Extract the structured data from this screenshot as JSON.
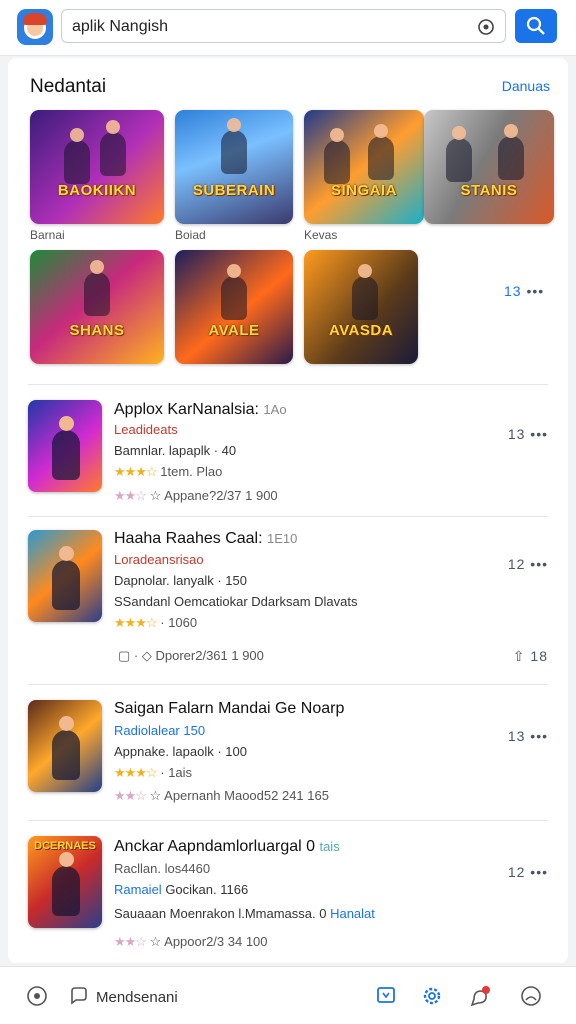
{
  "search": {
    "query": "aplik Nangish"
  },
  "section": {
    "title": "Nedantai",
    "link": "Danuas",
    "captions": [
      "Barnai",
      "Boiad",
      "Kevas"
    ],
    "more_count": "13",
    "tiles": [
      {
        "label": "BAOKIIKN",
        "bg": "linear-gradient(135deg,#3a1d7a,#b02fb8 55%,#ff7a2a)"
      },
      {
        "label": "SUBERAIN",
        "bg": "linear-gradient(160deg,#2e7fd9,#7ac0ff 40%,#3b3a6e)"
      },
      {
        "label": "SINGAIA",
        "bg": "linear-gradient(140deg,#1f3a8a,#ff9d2e 50%,#19b0c9)"
      },
      {
        "label": "STANIS",
        "bg": "linear-gradient(120deg,#c7c7c7,#7b7b7b 45%,#d9592a)"
      },
      {
        "label": "SHANS",
        "bg": "linear-gradient(140deg,#1e8a3a,#c72a7c 45%,#ffb21e)"
      },
      {
        "label": "AVALE",
        "bg": "linear-gradient(140deg,#1b1f5c,#ff6a1a 55%,#2a1b4a)"
      },
      {
        "label": "AVASDA",
        "bg": "linear-gradient(130deg,#ff9b1e,#5a3a1a 60%,#1b1b3a)"
      }
    ]
  },
  "apps": [
    {
      "title": "Applox KarNanalsia:",
      "title_num": "1Ao",
      "l1": "Leadideats",
      "l1_color": "grey",
      "l2": "Bamnlar. lapaplk · 40",
      "rating_count": "1tem. Plao",
      "l4": "Appane?2/37 1 900",
      "count": "13",
      "icon_bg": "linear-gradient(140deg,#2137a8,#d22bd1 55%,#ff7b2a)",
      "icon_tag": ""
    },
    {
      "title": "Haaha Raahes Caal:",
      "title_num": "1E10",
      "l1": "Loradeansrisao",
      "l1_color": "red",
      "l2": "Dapnolar. lanyalk · 150",
      "l3": "SSandanl Oemcatiokar Ddarksam Dlavats",
      "rating_count": "· 1060",
      "l4": "Dporer2/361 1 900",
      "count": "12",
      "count2": "18",
      "icon_bg": "linear-gradient(140deg,#2a9ad1,#ff8a1e 50%,#2b3f8a)",
      "icon_tag": ""
    },
    {
      "title": "Saigan Falarn Mandai Ge Noarp",
      "title_num": "",
      "l1": "Radiolalear 150",
      "l1_color": "blue",
      "l2": "Appnake. lapaolk · 100",
      "rating_count": "· 1ais",
      "l4": "Apernanh  Maood52 241 165",
      "count": "13",
      "icon_bg": "linear-gradient(140deg,#5a2a1a,#ffa82a 50%,#233f8a)",
      "icon_tag": ""
    },
    {
      "title": "Anckar Aapndamlorluargal 0",
      "title_num": "tais",
      "l1": "Racllan. los4460",
      "l1_color": "grey",
      "l2a": "Ramaiel",
      "l2": "Gocikan. 1166",
      "l3": "Sauaaan Moenrakon l.Mmamassa. 0",
      "l3b": "Hanalat",
      "l4": "Appoor2/3 34 100",
      "count": "12",
      "icon_bg": "linear-gradient(140deg,#ff9b1e,#c92a2a 50%,#2b3f8a)",
      "icon_tag": "DCERNAES"
    }
  ],
  "bottom_nav": {
    "label": "Mendsenani"
  },
  "colors": {
    "accent": "#1a73e8",
    "star": "#f2b01e"
  }
}
